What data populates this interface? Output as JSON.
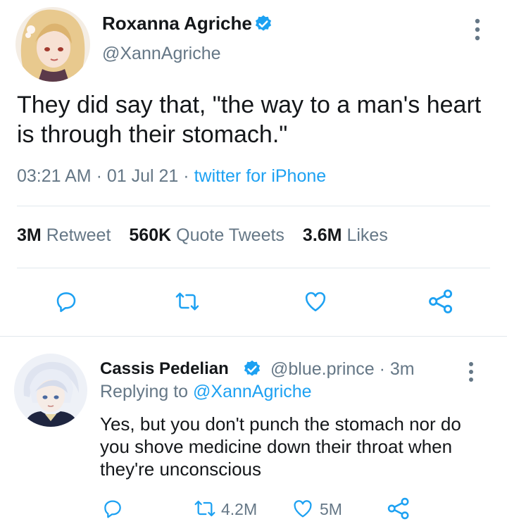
{
  "main_tweet": {
    "author": {
      "display_name": "Roxanna Agriche",
      "handle": "@XannAgriche",
      "verified": true
    },
    "text": "They did say that, \"the way to a man's heart is through their stomach.\"",
    "time": "03:21 AM",
    "date": "01 Jul 21",
    "source": "twitter for iPhone",
    "stats": {
      "retweets_count": "3M",
      "retweets_label": "Retweet",
      "quotes_count": "560K",
      "quotes_label": "Quote Tweets",
      "likes_count": "3.6M",
      "likes_label": "Likes"
    }
  },
  "reply": {
    "author": {
      "display_name": "Cassis Pedelian",
      "handle": "@blue.prince",
      "time_ago": "3m",
      "verified": true
    },
    "replying_label": "Replying to",
    "replying_to": "@XannAgriche",
    "text": "Yes, but you don't punch the stomach nor do you shove medicine down their throat when they're unconscious",
    "retweet_count": "4.2M",
    "like_count": "5M"
  },
  "icons": [
    "reply-icon",
    "retweet-icon",
    "like-icon",
    "share-icon",
    "more-icon",
    "verified-icon"
  ],
  "colors": {
    "accent": "#1da1f2",
    "icon": "#1da1f2",
    "text_secondary": "#657786",
    "divider": "#e1e8ed"
  }
}
